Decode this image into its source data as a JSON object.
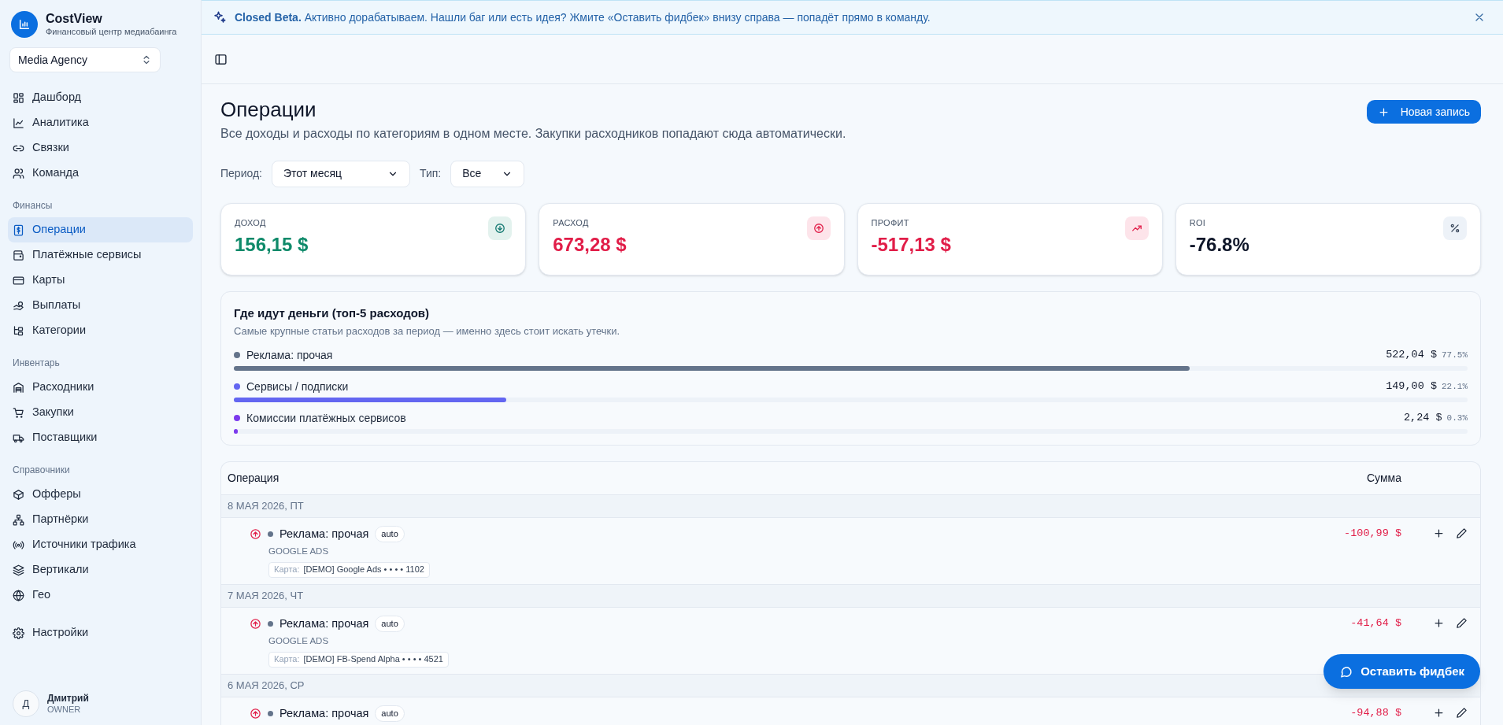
{
  "banner": {
    "text": "**Closed Beta.** Активно дорабатываем. Нашли баг или есть идея? Жмите «Оставить фидбек» внизу справа — попадёт прямо в команду."
  },
  "sidebar": {
    "brand": "CostView",
    "tagline": "Финансовый центр медиабаинга",
    "workspace": "Media Agency",
    "sections": [
      {
        "items": [
          {
            "label": "Дашборд",
            "selected": false
          },
          {
            "label": "Аналитика",
            "selected": false
          },
          {
            "label": "Связки",
            "selected": false
          },
          {
            "label": "Команда",
            "selected": false
          }
        ]
      },
      {
        "heading": "Финансы",
        "items": [
          {
            "label": "Операции",
            "selected": true
          },
          {
            "label": "Платёжные сервисы",
            "selected": false
          },
          {
            "label": "Карты",
            "selected": false
          },
          {
            "label": "Выплаты",
            "selected": false
          },
          {
            "label": "Категории",
            "selected": false
          }
        ]
      },
      {
        "heading": "Инвентарь",
        "items": [
          {
            "label": "Расходники",
            "selected": false
          },
          {
            "label": "Закупки",
            "selected": false
          },
          {
            "label": "Поставщики",
            "selected": false
          }
        ]
      },
      {
        "heading": "Справочники",
        "items": [
          {
            "label": "Офферы",
            "selected": false
          },
          {
            "label": "Партнёрки",
            "selected": false
          },
          {
            "label": "Источники трафика",
            "selected": false
          },
          {
            "label": "Вертикали",
            "selected": false
          },
          {
            "label": "Гео",
            "selected": false
          }
        ]
      },
      {
        "items": [
          {
            "label": "Настройки",
            "selected": false
          }
        ]
      }
    ],
    "user": {
      "initial": "Д",
      "name": "Дмитрий",
      "role": "OWNER"
    }
  },
  "page": {
    "title": "Операции",
    "subtitle": "Все доходы и расходы по категориям в одном месте. Закупки расходников попадают сюда автоматически.",
    "new_button": "Новая запись"
  },
  "filters": [
    {
      "label": "Период:",
      "value": "Этот месяц"
    },
    {
      "label": "Тип:",
      "value": "Все"
    }
  ],
  "kpis": [
    {
      "label": "ДОХОД",
      "value": "156,15 $",
      "kind": "income"
    },
    {
      "label": "РАСХОД",
      "value": "673,28 $",
      "kind": "expense"
    },
    {
      "label": "ПРОФИТ",
      "value": "-517,13 $",
      "kind": "profit"
    },
    {
      "label": "ROI",
      "value": "-76.8%",
      "kind": "roi"
    }
  ],
  "top_expenses": {
    "title": "Где идут деньги (топ-5 расходов)",
    "subtitle": "Самые крупные статьи расходов за период — именно здесь стоит искать утечки.",
    "items": [
      {
        "name": "Реклама: прочая",
        "amount": "522,04 $",
        "share": "77.5%",
        "level": 0.775,
        "color": "#64748b"
      },
      {
        "name": "Сервисы / подписки",
        "amount": "149,00 $",
        "share": "22.1%",
        "level": 0.221,
        "color": "#6366f1"
      },
      {
        "name": "Комиссии платёжных сервисов",
        "amount": "2,24 $",
        "share": "0.3%",
        "level": 0.003,
        "color": "#7c3aed"
      }
    ]
  },
  "table": {
    "columns": [
      "Операция",
      "Сумма"
    ],
    "groups": [
      {
        "date": "8 МАЯ 2026, ПТ",
        "rows": [
          {
            "category": "Реклама: прочая",
            "color": "#64748b",
            "badge": "auto",
            "source": "GOOGLE ADS",
            "card_label": "Карта:",
            "card": "[DEMO] Google Ads • • • • 1102",
            "amount": "-100,99 $",
            "kind": "expense"
          }
        ]
      },
      {
        "date": "7 МАЯ 2026, ЧТ",
        "rows": [
          {
            "category": "Реклама: прочая",
            "color": "#64748b",
            "badge": "auto",
            "source": "GOOGLE ADS",
            "card_label": "Карта:",
            "card": "[DEMO] FB-Spend Alpha • • • • 4521",
            "amount": "-41,64 $",
            "kind": "expense"
          }
        ]
      },
      {
        "date": "6 МАЯ 2026, СР",
        "rows": [
          {
            "category": "Реклама: прочая",
            "color": "#64748b",
            "badge": "auto",
            "amount": "-94,88 $",
            "kind": "expense"
          }
        ]
      }
    ]
  },
  "feedback_button": "Оставить фидбек"
}
